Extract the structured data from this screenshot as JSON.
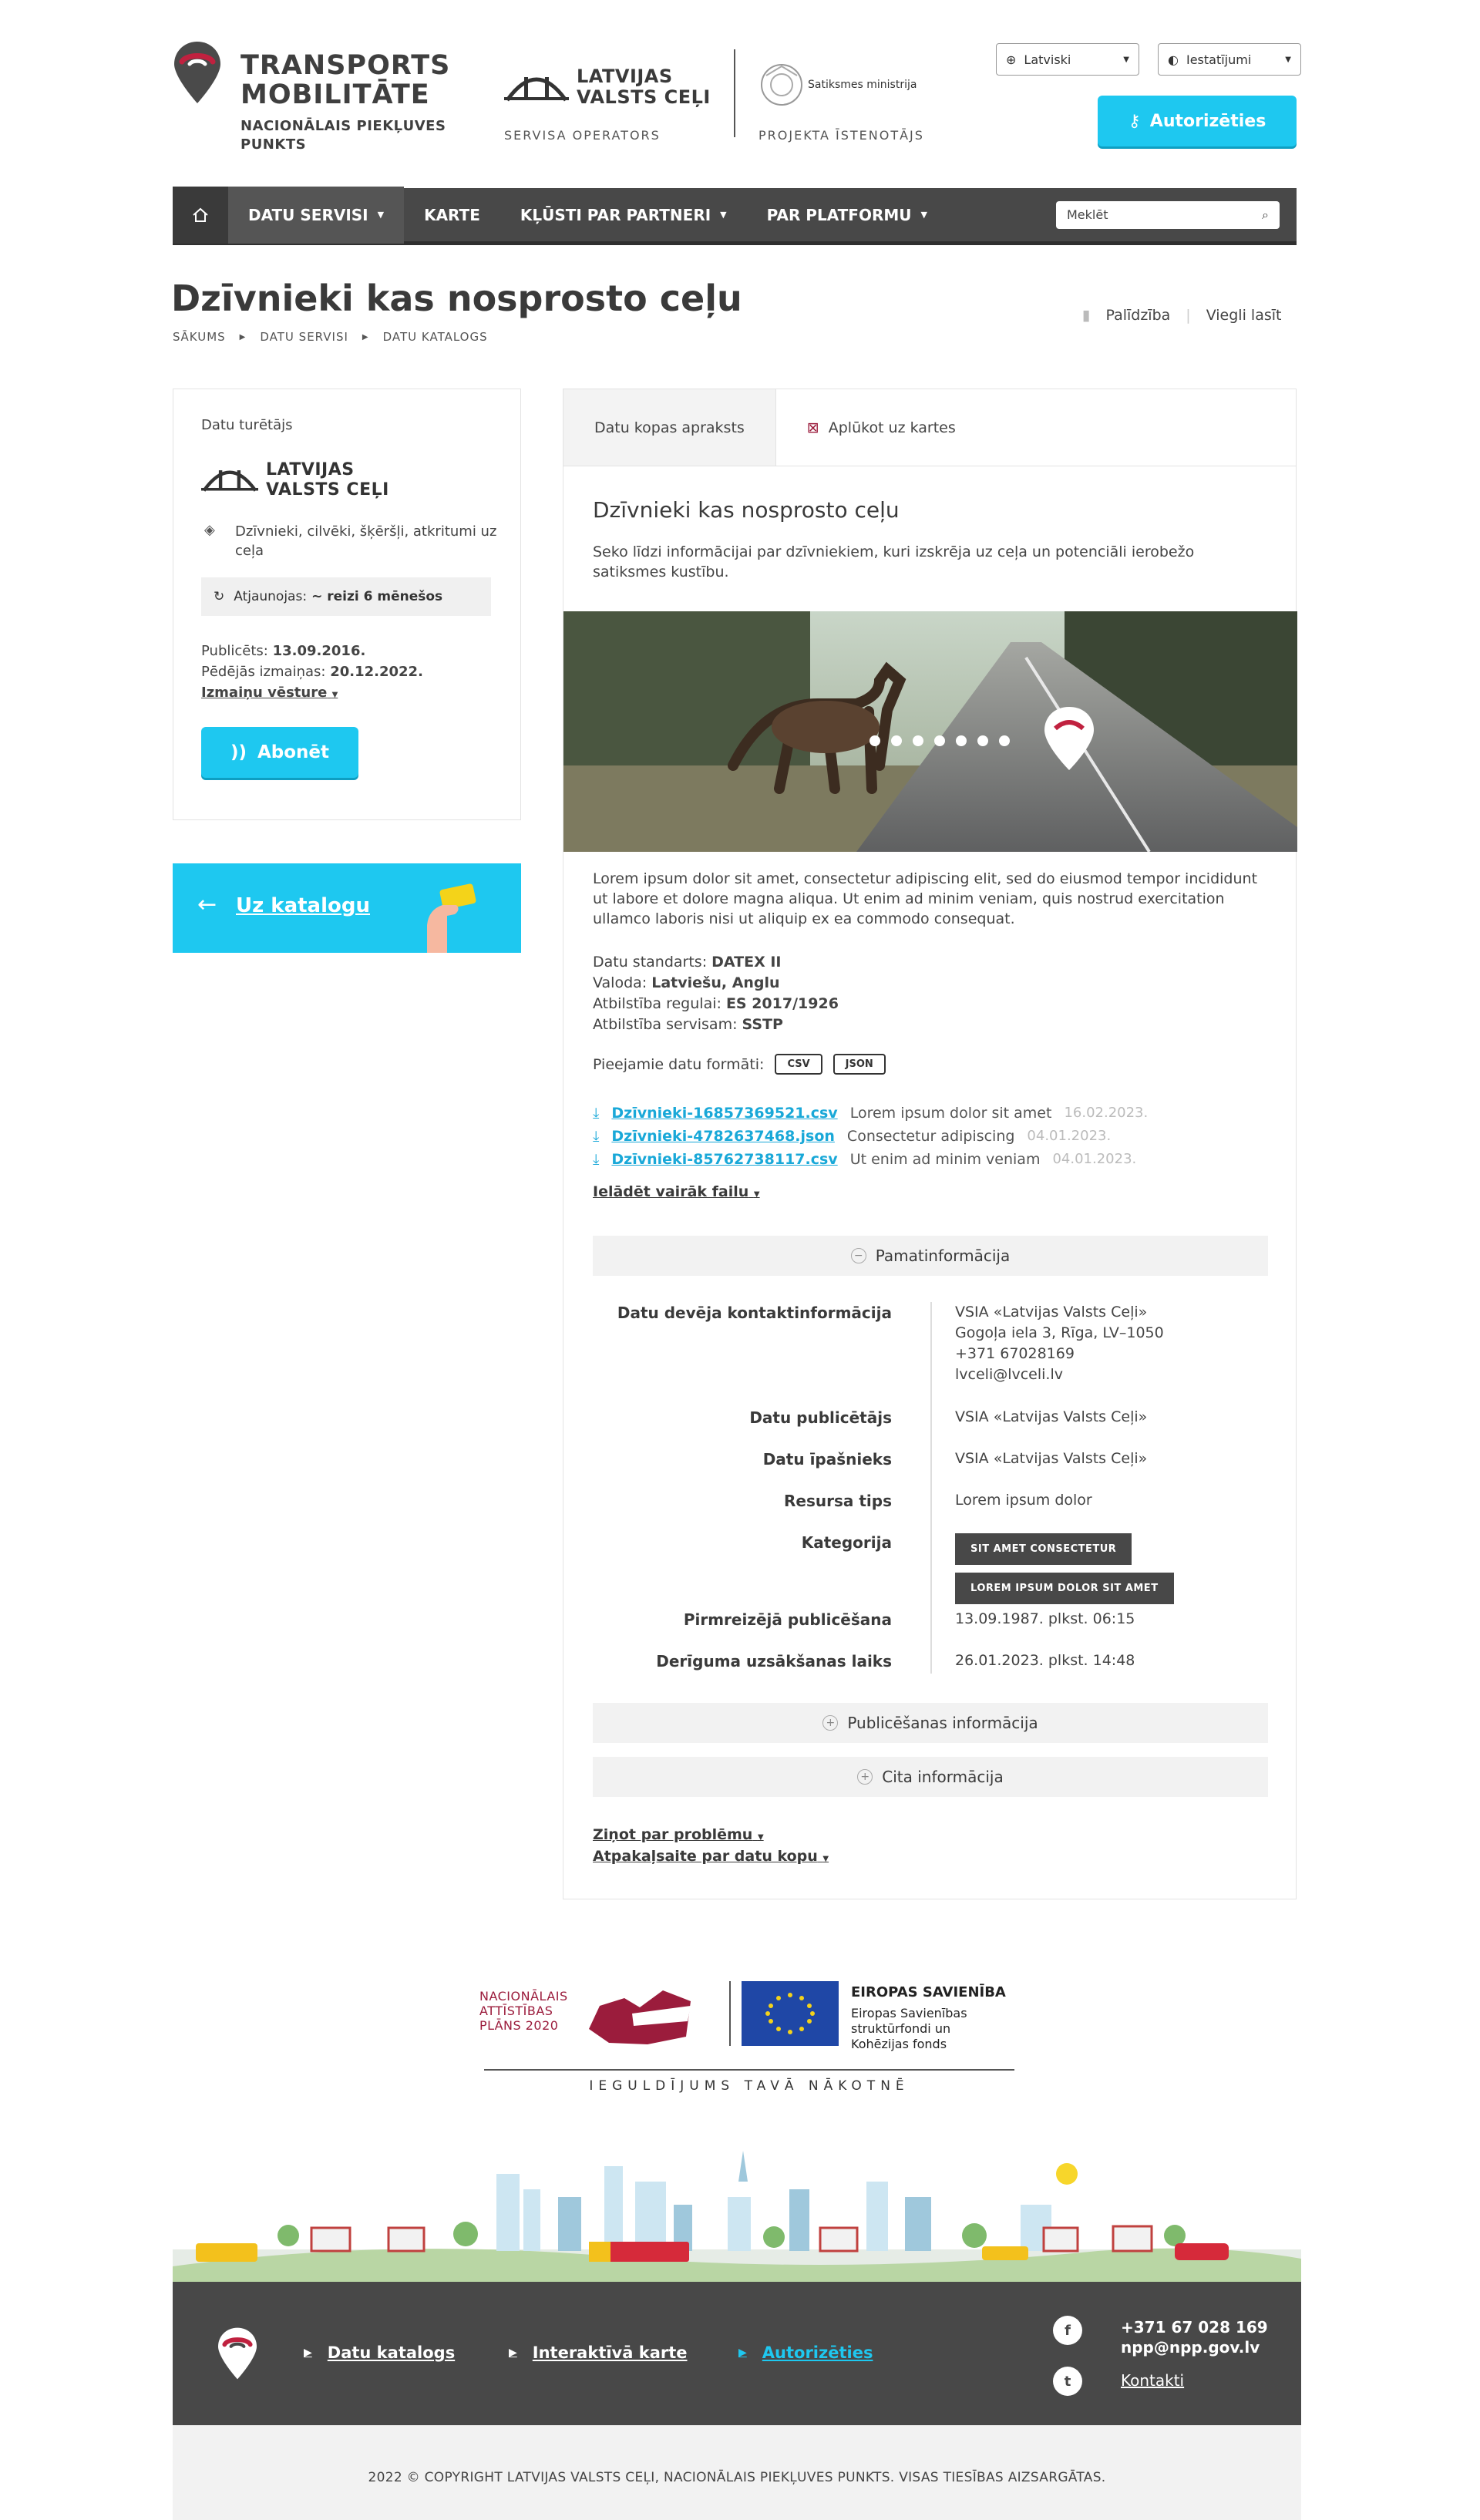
{
  "header": {
    "brand_title_1": "TRANSPORTS",
    "brand_title_2": "MOBILITĀTE",
    "brand_sub_1": "NACIONĀLAIS PIEKĻUVES",
    "brand_sub_2": "PUNKTS",
    "operator_name_1": "LATVIJAS",
    "operator_name_2": "VALSTS CEĻI",
    "operator_caption": "SERVISA OPERATORS",
    "ministry_name": "Satiksmes ministrija",
    "ministry_caption": "PROJEKTA ĪSTENOTĀJS",
    "language": "Latviski",
    "settings": "Iestatījumi",
    "login": "Autorizēties"
  },
  "nav": {
    "items": [
      {
        "label": "DATU SERVISI",
        "dropdown": true
      },
      {
        "label": "KARTE",
        "dropdown": false
      },
      {
        "label": "KĻŪSTI PAR PARTNERI",
        "dropdown": true
      },
      {
        "label": "PAR PLATFORMU",
        "dropdown": true
      }
    ],
    "search_placeholder": "Meklēt"
  },
  "page": {
    "title": "Dzīvnieki kas nosprosto ceļu",
    "breadcrumb": [
      "SĀKUMS",
      "DATU SERVISI",
      "DATU KATALOGS"
    ],
    "help": "Palīdzība",
    "easy_read": "Viegli lasīt"
  },
  "sidebar": {
    "holder_label": "Datu turētājs",
    "holder_name_1": "LATVIJAS",
    "holder_name_2": "VALSTS CEĻI",
    "category": "Dzīvnieki, cilvēki, šķēršļi, atkritumi uz ceļa",
    "update_label": "Atjaunojas:",
    "update_value": "~ reizi 6 mēnešos",
    "published_label": "Publicēts:",
    "published_value": "13.09.2016.",
    "changed_label": "Pēdējās izmaiņas:",
    "changed_value": "20.12.2022.",
    "history": "Izmaiņu vēsture",
    "subscribe": "Abonēt",
    "catalog_btn": "Uz katalogu"
  },
  "main": {
    "tabs": [
      "Datu kopas apraksts",
      "Aplūkot uz kartes"
    ],
    "title": "Dzīvnieki kas nosprosto ceļu",
    "lead": "Seko līdzi informācijai par dzīvniekiem, kuri izskrēja uz ceļa un potenciāli ierobežo satiksmes kustību.",
    "body": "Lorem ipsum dolor sit amet, consectetur adipiscing elit, sed do eiusmod tempor incididunt ut labore et dolore magna aliqua. Ut enim ad minim veniam, quis nostrud exercitation ullamco laboris nisi ut aliquip ex ea commodo consequat.",
    "meta": [
      {
        "label": "Datu standarts:",
        "value": "DATEX II"
      },
      {
        "label": "Valoda:",
        "value": "Latviešu, Anglu"
      },
      {
        "label": "Atbilstība regulai:",
        "value": "ES 2017/1926"
      },
      {
        "label": "Atbilstība servisam:",
        "value": "SSTP"
      }
    ],
    "formats_label": "Pieejamie datu formāti:",
    "formats": [
      "CSV",
      "JSON"
    ],
    "files": [
      {
        "name": "Dzīvnieki-16857369521.csv",
        "desc": "Lorem ipsum dolor sit amet",
        "date": "16.02.2023."
      },
      {
        "name": "Dzīvnieki-4782637468.json",
        "desc": "Consectetur adipiscing",
        "date": "04.01.2023."
      },
      {
        "name": "Dzīvnieki-85762738117.csv",
        "desc": "Ut enim ad minim veniam",
        "date": "04.01.2023."
      }
    ],
    "more_files": "Ielādēt vairāk failu",
    "acc_basic": "Pamatinformācija",
    "info": {
      "contact_label": "Datu devēja kontaktinformācija",
      "contact_lines": [
        "VSIA «Latvijas Valsts Ceļi»",
        "Gogoļa iela 3, Rīga, LV–1050",
        "+371 67028169",
        "lvceli@lvceli.lv"
      ],
      "publisher_label": "Datu publicētājs",
      "publisher": "VSIA «Latvijas Valsts Ceļi»",
      "owner_label": "Datu īpašnieks",
      "owner": "VSIA «Latvijas Valsts Ceļi»",
      "type_label": "Resursa tips",
      "type": "Lorem ipsum dolor",
      "category_label": "Kategorija",
      "tags": [
        "SIT AMET CONSECTETUR",
        "LOREM IPSUM DOLOR SIT AMET"
      ],
      "first_pub_label": "Pirmreizējā publicēšana",
      "first_pub": "13.09.1987. plkst. 06:15",
      "delivery_label": "Derīguma uzsākšanas laiks",
      "delivery": "26.01.2023. plkst. 14:48"
    },
    "acc_pub": "Publicēšanas informācija",
    "acc_other": "Cita informācija",
    "report": "Ziņot par problēmu",
    "feedback": "Atpakaļsaite par datu kopu"
  },
  "funding": {
    "nap_1": "NACIONĀLAIS",
    "nap_2": "ATTĪSTĪBAS",
    "nap_3": "PLĀNS 2020",
    "eu_title": "EIROPAS SAVIENĪBA",
    "eu_sub_1": "Eiropas Savienības",
    "eu_sub_2": "struktūrfondi un",
    "eu_sub_3": "Kohēzijas fonds",
    "motto": "IEGULDĪJUMS TAVĀ NĀKOTNĒ"
  },
  "footer": {
    "links": [
      "Datu katalogs",
      "Interaktīvā karte",
      "Autorizēties"
    ],
    "phone": "+371 67 028 169",
    "email": "npp@npp.gov.lv",
    "contacts": "Kontakti",
    "copyright": "2022 © COPYRIGHT LATVIJAS VALSTS CEĻI, NACIONĀLAIS PIEKĻUVES PUNKTS. VISAS TIESĪBAS AIZSARGĀTAS."
  },
  "colors": {
    "accent": "#1ec8f0",
    "dark": "#484848",
    "brand_red": "#9b1c3c"
  }
}
